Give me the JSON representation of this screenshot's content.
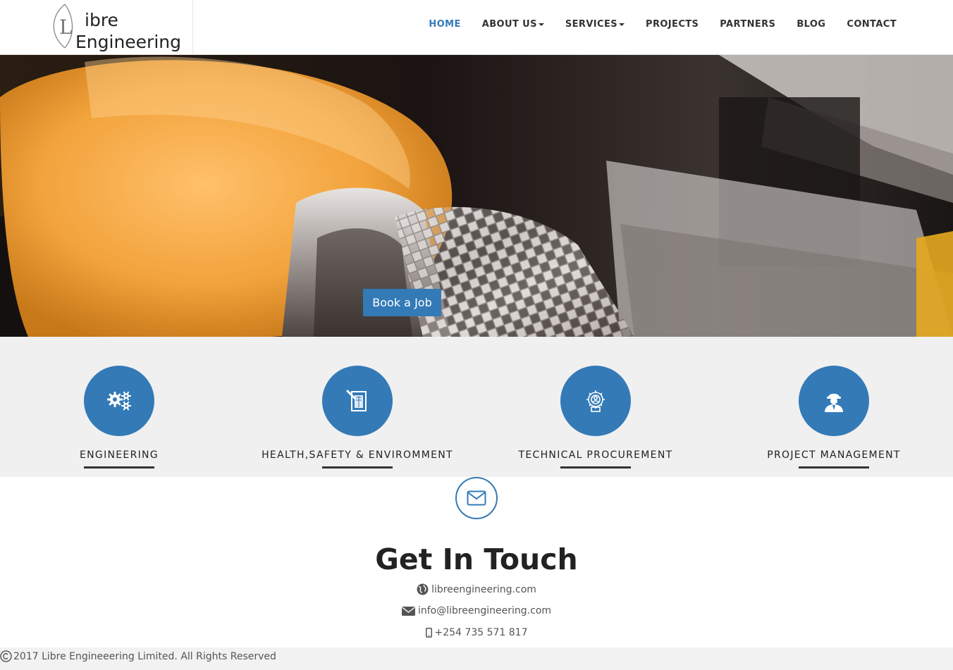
{
  "brand": {
    "line1": "ibre",
    "line2": "Engineering",
    "logo_letter": "L"
  },
  "nav": {
    "items": [
      {
        "label": "HOME",
        "active": true,
        "dropdown": false
      },
      {
        "label": "ABOUT US",
        "active": false,
        "dropdown": true
      },
      {
        "label": "SERVICES",
        "active": false,
        "dropdown": true
      },
      {
        "label": "PROJECTS",
        "active": false,
        "dropdown": false
      },
      {
        "label": "PARTNERS",
        "active": false,
        "dropdown": false
      },
      {
        "label": "BLOG",
        "active": false,
        "dropdown": false
      },
      {
        "label": "CONTACT",
        "active": false,
        "dropdown": false
      }
    ]
  },
  "hero": {
    "button_label": "Book a Job"
  },
  "services": [
    {
      "label": "ENGINEERING",
      "icon": "gears-icon"
    },
    {
      "label": "HEALTH,SAFETY & ENVIROMMENT",
      "icon": "blueprint-icon"
    },
    {
      "label": "TECHNICAL PROCUREMENT",
      "icon": "procurement-gear-icon"
    },
    {
      "label": "PROJECT MANAGEMENT",
      "icon": "engineer-icon"
    }
  ],
  "contact": {
    "title": "Get In Touch",
    "website": "libreengineering.com",
    "email": "info@libreengineering.com",
    "phone": "+254 735 571 817"
  },
  "footer": {
    "text": "2017 Libre Engineeering Limited. All Rights Reserved"
  },
  "colors": {
    "accent": "#337ab7",
    "services_bg": "#f0f0f0",
    "dark_bar": "#333333"
  }
}
